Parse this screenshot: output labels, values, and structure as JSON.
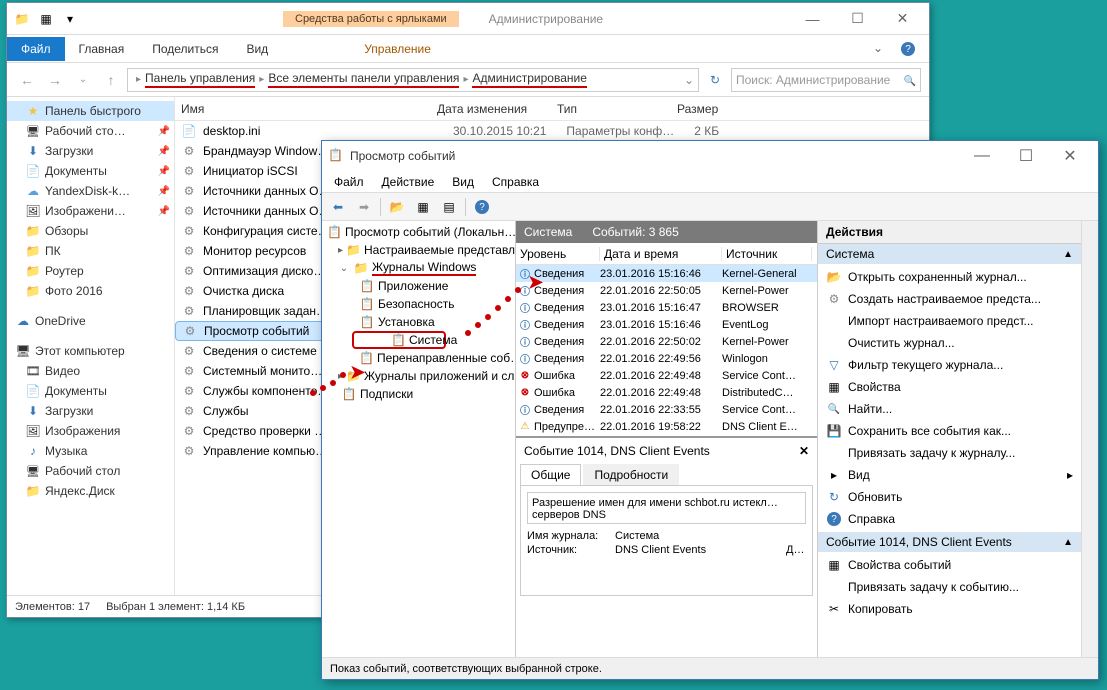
{
  "explorer": {
    "contextual_tab": "Средства работы с ярлыками",
    "title": "Администрирование",
    "ribbon": {
      "file": "Файл",
      "home": "Главная",
      "share": "Поделиться",
      "view": "Вид",
      "manage": "Управление"
    },
    "breadcrumb": [
      "Панель управления",
      "Все элементы панели управления",
      "Администрирование"
    ],
    "search_placeholder": "Поиск: Администрирование",
    "columns": {
      "name": "Имя",
      "date": "Дата изменения",
      "type": "Тип",
      "size": "Размер"
    },
    "sidebar": {
      "quick": "Панель быстрого",
      "items1": [
        "Рабочий сто…",
        "Загрузки",
        "Документы",
        "YandexDisk-k…",
        "Изображени…",
        "Обзоры",
        "ПК",
        "Роутер",
        "Фото 2016"
      ],
      "onedrive": "OneDrive",
      "thispc": "Этот компьютер",
      "items2": [
        "Видео",
        "Документы",
        "Загрузки",
        "Изображения",
        "Музыка",
        "Рабочий стол",
        "Яндекс.Диск"
      ]
    },
    "files": [
      {
        "n": "desktop.ini",
        "d": "30.10.2015 10:21",
        "t": "Параметры конф…",
        "s": "2 КБ"
      },
      {
        "n": "Брандмауэр Window…"
      },
      {
        "n": "Инициатор iSCSI"
      },
      {
        "n": "Источники данных O…"
      },
      {
        "n": "Источники данных O…"
      },
      {
        "n": "Конфигурация систе…"
      },
      {
        "n": "Монитор ресурсов"
      },
      {
        "n": "Оптимизация диско…"
      },
      {
        "n": "Очистка диска"
      },
      {
        "n": "Планировщик задан…"
      },
      {
        "n": "Просмотр событий",
        "sel": true
      },
      {
        "n": "Сведения о системе"
      },
      {
        "n": "Системный монито…"
      },
      {
        "n": "Службы компоненто…"
      },
      {
        "n": "Службы"
      },
      {
        "n": "Средство проверки …"
      },
      {
        "n": "Управление компью…"
      }
    ],
    "status": {
      "count": "Элементов: 17",
      "sel": "Выбран 1 элемент: 1,14 КБ"
    }
  },
  "eventviewer": {
    "title": "Просмотр событий",
    "menu": [
      "Файл",
      "Действие",
      "Вид",
      "Справка"
    ],
    "tree": {
      "root": "Просмотр событий (Локальн…",
      "custom": "Настраиваемые представле…",
      "winlogs": "Журналы Windows",
      "items": [
        "Приложение",
        "Безопасность",
        "Установка",
        "Система",
        "Перенаправленные соб…"
      ],
      "applogs": "Журналы приложений и сл…",
      "subs": "Подписки"
    },
    "center": {
      "head_title": "Система",
      "head_count": "Событий: 3 865",
      "cols": {
        "level": "Уровень",
        "date": "Дата и время",
        "src": "Источник"
      },
      "rows": [
        {
          "t": "info",
          "l": "Сведения",
          "d": "23.01.2016 15:16:46",
          "s": "Kernel-General",
          "sel": true
        },
        {
          "t": "info",
          "l": "Сведения",
          "d": "22.01.2016 22:50:05",
          "s": "Kernel-Power"
        },
        {
          "t": "info",
          "l": "Сведения",
          "d": "23.01.2016 15:16:47",
          "s": "BROWSER"
        },
        {
          "t": "info",
          "l": "Сведения",
          "d": "23.01.2016 15:16:46",
          "s": "EventLog"
        },
        {
          "t": "info",
          "l": "Сведения",
          "d": "22.01.2016 22:50:02",
          "s": "Kernel-Power"
        },
        {
          "t": "info",
          "l": "Сведения",
          "d": "22.01.2016 22:49:56",
          "s": "Winlogon"
        },
        {
          "t": "err",
          "l": "Ошибка",
          "d": "22.01.2016 22:49:48",
          "s": "Service Cont…"
        },
        {
          "t": "err",
          "l": "Ошибка",
          "d": "22.01.2016 22:49:48",
          "s": "DistributedC…"
        },
        {
          "t": "info",
          "l": "Сведения",
          "d": "22.01.2016 22:33:55",
          "s": "Service Cont…"
        },
        {
          "t": "warn",
          "l": "Предупре…",
          "d": "22.01.2016 19:58:22",
          "s": "DNS Client E…"
        }
      ],
      "detail_title": "Событие 1014, DNS Client Events",
      "tabs": [
        "Общие",
        "Подробности"
      ],
      "detail_msg": "Разрешение имен для имени schbot.ru истекл…",
      "detail_msg2": "серверов DNS",
      "journal_lbl": "Имя журнала:",
      "journal_val": "Система",
      "src_lbl": "Источник:",
      "src_val": "DNS Client Events",
      "date_lbl": "Д…"
    },
    "actions": {
      "head": "Действия",
      "sec1": "Система",
      "items1": [
        {
          "i": "open",
          "t": "Открыть сохраненный журнал..."
        },
        {
          "i": "gear",
          "t": "Создать настраиваемое предста..."
        },
        {
          "i": "",
          "t": "Импорт настраиваемого предст..."
        },
        {
          "i": "",
          "t": "Очистить журнал..."
        },
        {
          "i": "filter",
          "t": "Фильтр текущего журнала..."
        },
        {
          "i": "prop",
          "t": "Свойства"
        },
        {
          "i": "find",
          "t": "Найти..."
        },
        {
          "i": "save",
          "t": "Сохранить все события как..."
        },
        {
          "i": "",
          "t": "Привязать задачу к журналу..."
        },
        {
          "i": "view",
          "t": "Вид"
        },
        {
          "i": "refresh",
          "t": "Обновить"
        },
        {
          "i": "help",
          "t": "Справка"
        }
      ],
      "sec2": "Событие 1014, DNS Client Events",
      "items2": [
        {
          "i": "prop",
          "t": "Свойства событий"
        },
        {
          "i": "",
          "t": "Привязать задачу к событию..."
        },
        {
          "i": "cut",
          "t": "Копировать"
        }
      ]
    },
    "status": "Показ событий, соответствующих выбранной строке."
  }
}
